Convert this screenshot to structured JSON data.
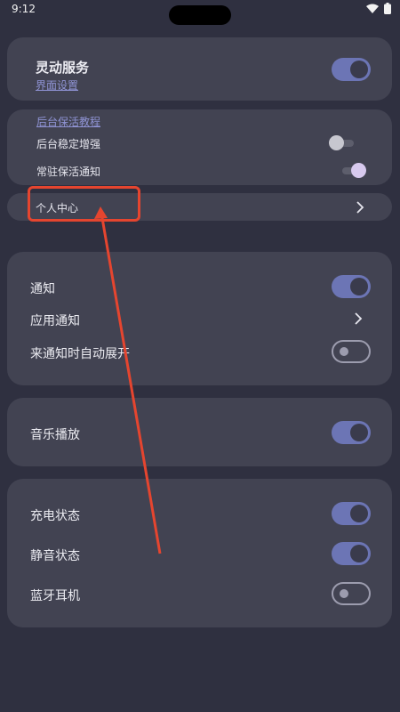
{
  "status": {
    "time": "9:12"
  },
  "service_card": {
    "title": "灵动服务",
    "link": "界面设置",
    "toggle_on": true
  },
  "keepalive_card": {
    "tutorial_link": "后台保活教程",
    "items": [
      {
        "label": "后台稳定增强",
        "state": "off"
      },
      {
        "label": "常驻保活通知",
        "state": "on"
      }
    ]
  },
  "personal_center": {
    "label": "个人中心"
  },
  "notify_card": {
    "items": [
      {
        "label": "通知",
        "control": "toggle-on"
      },
      {
        "label": "应用通知",
        "control": "chevron"
      },
      {
        "label": "来通知时自动展开",
        "control": "toggle-off"
      }
    ]
  },
  "music_card": {
    "label": "音乐播放",
    "toggle_on": true
  },
  "status_card": {
    "items": [
      {
        "label": "充电状态",
        "control": "toggle-on"
      },
      {
        "label": "静音状态",
        "control": "toggle-on"
      },
      {
        "label": "蓝牙耳机",
        "control": "toggle-off"
      }
    ]
  },
  "colors": {
    "background": "#2f3040",
    "card": "#424352",
    "toggle_accent": "#6c75b5",
    "link": "#8f93d4",
    "annotation": "#e5452f"
  }
}
